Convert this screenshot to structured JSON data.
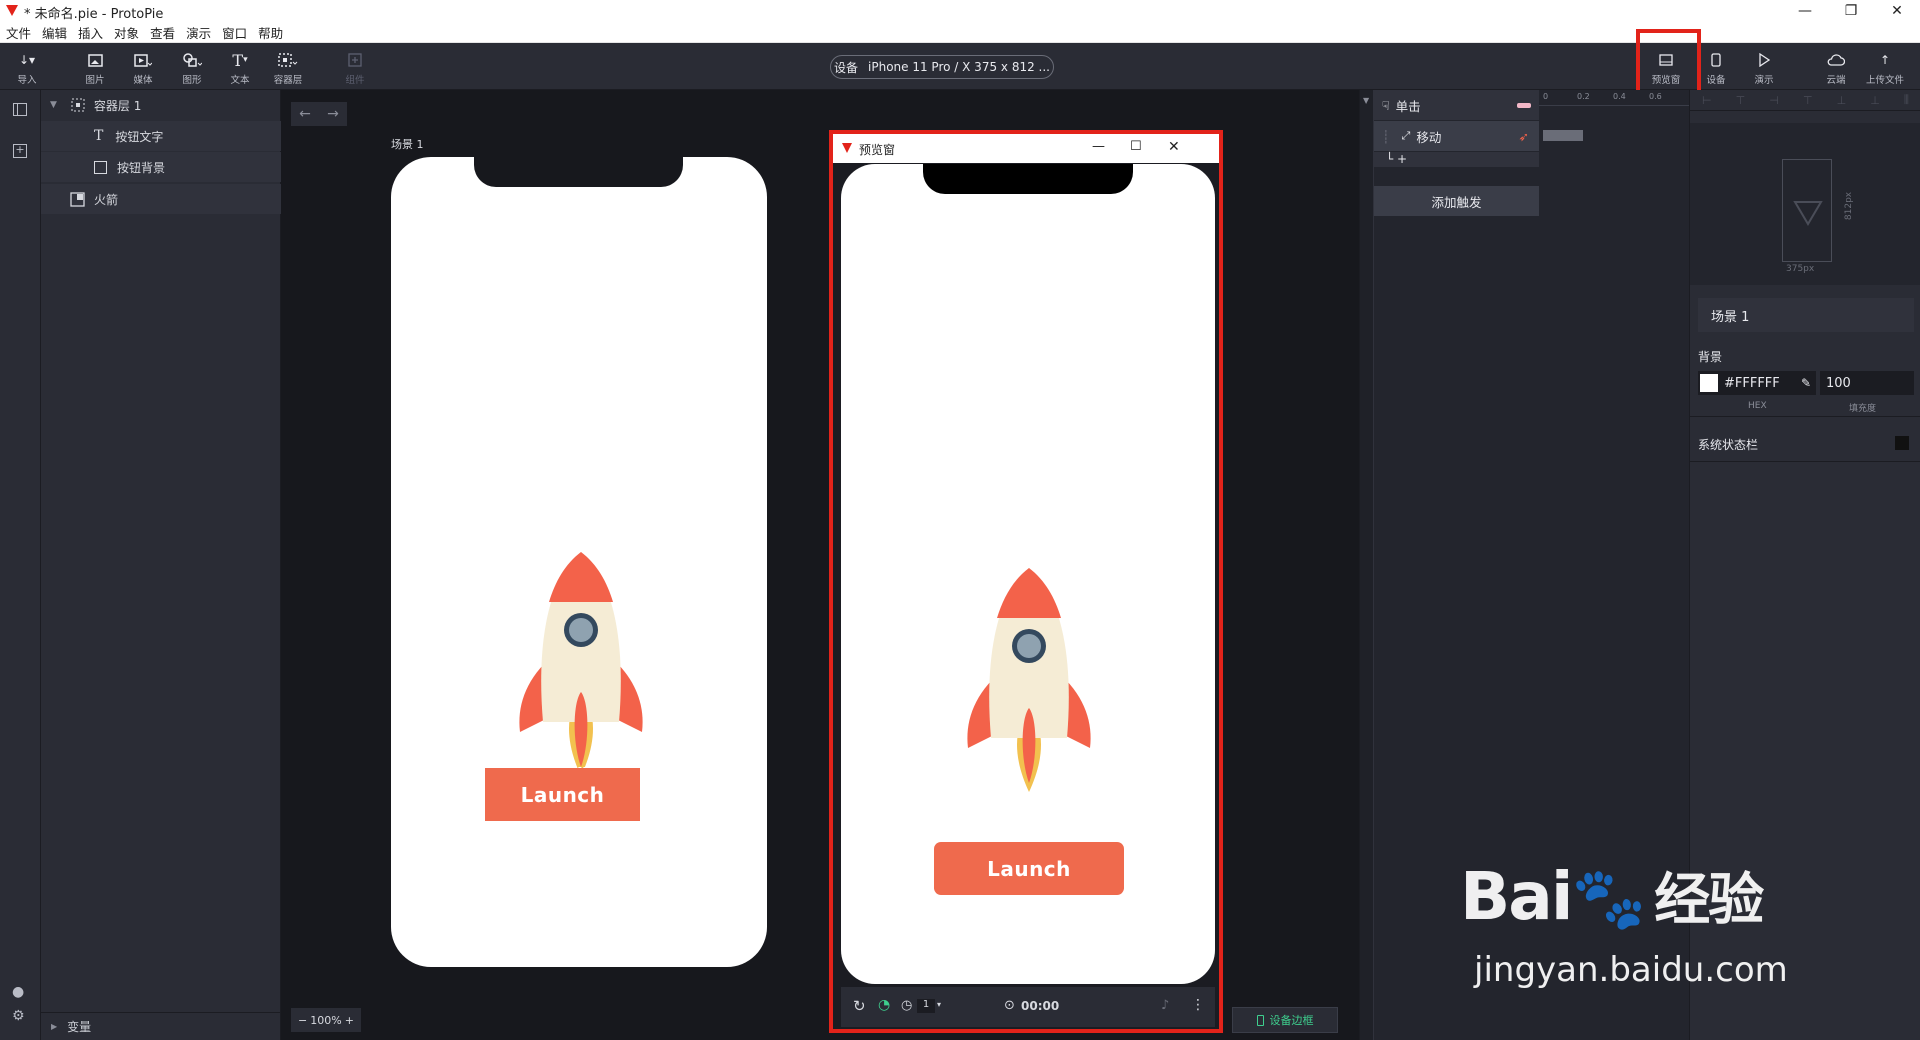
{
  "window": {
    "title": "* 未命名.pie - ProtoPie"
  },
  "menu": [
    "文件",
    "编辑",
    "插入",
    "对象",
    "查看",
    "演示",
    "窗口",
    "帮助"
  ],
  "toolbar": {
    "left": [
      {
        "label": "导入",
        "icon": "import-icon"
      },
      {
        "label": "图片",
        "icon": "image-icon"
      },
      {
        "label": "媒体",
        "icon": "media-icon"
      },
      {
        "label": "图形",
        "icon": "shape-icon"
      },
      {
        "label": "文本",
        "icon": "text-icon"
      },
      {
        "label": "容器层",
        "icon": "container-icon"
      },
      {
        "label": "组件",
        "icon": "component-icon"
      }
    ],
    "device": "设备",
    "device_value": "iPhone 11 Pro / X  375 x 812 ...",
    "right": [
      {
        "label": "预览窗",
        "icon": "preview-window-icon"
      },
      {
        "label": "设备",
        "icon": "device-icon"
      },
      {
        "label": "演示",
        "icon": "play-icon"
      },
      {
        "label": "云端",
        "icon": "cloud-icon"
      },
      {
        "label": "上传文件",
        "icon": "upload-icon"
      }
    ]
  },
  "layers": [
    {
      "label": "容器层 1",
      "icon": "container-icon"
    },
    {
      "label": "按钮文字",
      "icon": "text-layer-icon"
    },
    {
      "label": "按钮背景",
      "icon": "rect-layer-icon"
    },
    {
      "label": "火箭",
      "icon": "image-layer-icon"
    }
  ],
  "variables": "变量",
  "canvas": {
    "scene_label": "场景 1",
    "zoom": "100%",
    "button_text": "Launch",
    "device_frame": "设备边框"
  },
  "preview": {
    "title": "预览窗",
    "button_text": "Launch",
    "time": "00:00",
    "speed": "1"
  },
  "interaction": {
    "trigger": "单击",
    "response": "移动",
    "add_trigger": "添加触发",
    "ruler": [
      "0",
      "0.2",
      "0.4",
      "0.6"
    ]
  },
  "properties": {
    "width": "375px",
    "height": "812px",
    "scene_name": "场景 1",
    "background_label": "背景",
    "hex": "#FFFFFF",
    "opacity": "100",
    "hex_caption": "HEX",
    "opacity_caption": "填充度",
    "statusbar": "系统状态栏"
  },
  "watermark": {
    "brand": "Bai",
    "brand2": "经验",
    "url": "jingyan.baidu.com"
  },
  "colors": {
    "accent": "#ef6a4d",
    "highlight": "#e2231a",
    "rocket": "#f3624a",
    "rocket_body": "#f5ecd5",
    "flame": "#f2c14f"
  }
}
